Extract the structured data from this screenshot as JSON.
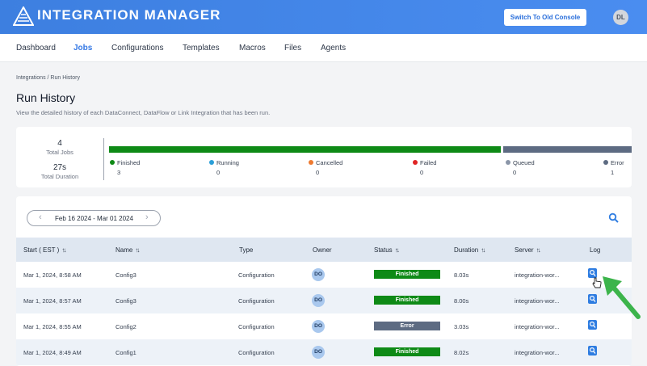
{
  "app": {
    "brand": "INTEGRATION MANAGER",
    "switch_label": "Switch To Old Console",
    "avatar_initials": "DL",
    "accent_color": "#3d7fe0"
  },
  "nav": {
    "items": [
      "Dashboard",
      "Jobs",
      "Configurations",
      "Templates",
      "Macros",
      "Files",
      "Agents"
    ],
    "active": "Jobs"
  },
  "breadcrumb": "Integrations / Run History",
  "page": {
    "title": "Run History",
    "subtitle": "View the detailed history of each DataConnect, DataFlow or Link Integration that has been run."
  },
  "summary": {
    "total_jobs": "4",
    "total_jobs_label": "Total Jobs",
    "total_duration": "27s",
    "total_duration_label": "Total Duration",
    "statuses": [
      {
        "label": "Finished",
        "count": "3",
        "color": "#0e8a16"
      },
      {
        "label": "Running",
        "count": "0",
        "color": "#2b9fd8"
      },
      {
        "label": "Cancelled",
        "count": "0",
        "color": "#ee7a30"
      },
      {
        "label": "Failed",
        "count": "0",
        "color": "#e02424"
      },
      {
        "label": "Queued",
        "count": "0",
        "color": "#8b96a8"
      },
      {
        "label": "Error",
        "count": "1",
        "color": "#5d6b82"
      }
    ]
  },
  "filters": {
    "date_range": "Feb 16 2024 - Mar 01 2024",
    "prev_icon": "chevron-left-icon",
    "next_icon": "chevron-right-icon",
    "search_icon": "search-icon"
  },
  "table": {
    "columns": [
      "Start ( EST )",
      "Name",
      "Type",
      "Owner",
      "Status",
      "Duration",
      "Server",
      "Log"
    ],
    "sort_icon": "↑↓",
    "rows": [
      {
        "start": "Mar 1, 2024, 8:58 AM",
        "name": "Config3",
        "type": "Configuration",
        "owner": "DO",
        "status": "Finished",
        "duration": "8.03s",
        "server": "integration-wor..."
      },
      {
        "start": "Mar 1, 2024, 8:57 AM",
        "name": "Config3",
        "type": "Configuration",
        "owner": "DO",
        "status": "Finished",
        "duration": "8.00s",
        "server": "integration-wor..."
      },
      {
        "start": "Mar 1, 2024, 8:55 AM",
        "name": "Config2",
        "type": "Configuration",
        "owner": "DO",
        "status": "Error",
        "duration": "3.03s",
        "server": "integration-wor..."
      },
      {
        "start": "Mar 1, 2024, 8:49 AM",
        "name": "Config1",
        "type": "Configuration",
        "owner": "DO",
        "status": "Finished",
        "duration": "8.02s",
        "server": "integration-wor..."
      }
    ],
    "status_colors": {
      "Finished": "#0e8a16",
      "Error": "#5d6b82"
    }
  }
}
